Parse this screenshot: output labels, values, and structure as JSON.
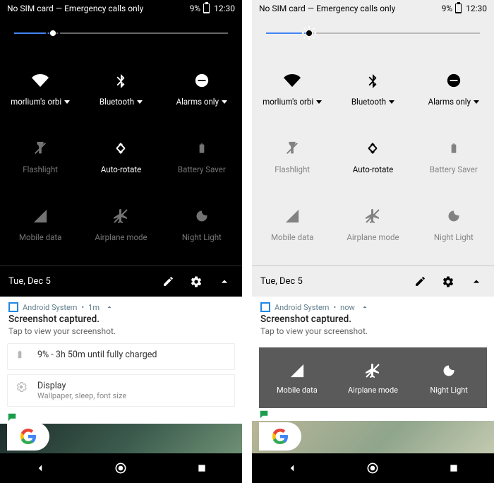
{
  "left": {
    "status": {
      "sim": "No SIM card — Emergency calls only",
      "battery_pct": "9%",
      "time": "12:30"
    },
    "brightness_pct": 18,
    "tiles": [
      {
        "key": "wifi",
        "label": "morlium's orbi",
        "dropdown": true,
        "active": true
      },
      {
        "key": "bluetooth",
        "label": "Bluetooth",
        "dropdown": true,
        "active": true
      },
      {
        "key": "dnd",
        "label": "Alarms only",
        "dropdown": true,
        "active": true
      },
      {
        "key": "flashlight",
        "label": "Flashlight",
        "dropdown": false,
        "active": false
      },
      {
        "key": "autorotate",
        "label": "Auto-rotate",
        "dropdown": false,
        "active": true
      },
      {
        "key": "battery",
        "label": "Battery Saver",
        "dropdown": false,
        "active": false
      },
      {
        "key": "mobiledata",
        "label": "Mobile data",
        "dropdown": false,
        "active": false
      },
      {
        "key": "airplane",
        "label": "Airplane mode",
        "dropdown": false,
        "active": false
      },
      {
        "key": "nightlight",
        "label": "Night Light",
        "dropdown": false,
        "active": false
      }
    ],
    "footer": {
      "date": "Tue, Dec 5"
    },
    "notif": {
      "app": "Android System",
      "age": "1m",
      "title": "Screenshot captured.",
      "sub": "Tap to view your screenshot."
    },
    "sub_notifs": [
      {
        "icon": "battery-small",
        "line1": "9% - 3h 50m until fully charged",
        "line2": ""
      },
      {
        "icon": "settings",
        "line1": "Display",
        "line2": "Wallpaper, sleep, font size"
      }
    ]
  },
  "right": {
    "status": {
      "sim": "No SIM card — Emergency calls only",
      "battery_pct": "9%",
      "time": "12:30"
    },
    "brightness_pct": 20,
    "tiles": [
      {
        "key": "wifi",
        "label": "morlium's orbi",
        "dropdown": true,
        "active": true
      },
      {
        "key": "bluetooth",
        "label": "Bluetooth",
        "dropdown": true,
        "active": true
      },
      {
        "key": "dnd",
        "label": "Alarms only",
        "dropdown": true,
        "active": true
      },
      {
        "key": "flashlight",
        "label": "Flashlight",
        "dropdown": false,
        "active": false
      },
      {
        "key": "autorotate",
        "label": "Auto-rotate",
        "dropdown": false,
        "active": true
      },
      {
        "key": "battery",
        "label": "Battery Saver",
        "dropdown": false,
        "active": false
      },
      {
        "key": "mobiledata",
        "label": "Mobile data",
        "dropdown": false,
        "active": false
      },
      {
        "key": "airplane",
        "label": "Airplane mode",
        "dropdown": false,
        "active": false
      },
      {
        "key": "nightlight",
        "label": "Night Light",
        "dropdown": false,
        "active": false
      }
    ],
    "footer": {
      "date": "Tue, Dec 5"
    },
    "notif": {
      "app": "Android System",
      "age": "now",
      "title": "Screenshot captured.",
      "sub": "Tap to view your screenshot."
    },
    "preview_tiles": [
      {
        "key": "mobiledata",
        "label": "Mobile data"
      },
      {
        "key": "airplane",
        "label": "Airplane mode"
      },
      {
        "key": "nightlight",
        "label": "Night Light"
      }
    ]
  },
  "icons_note": "wifi,bluetooth,dnd,flashlight,autorotate,battery,mobiledata,airplane,nightlight,edit,gear,chevron-up"
}
